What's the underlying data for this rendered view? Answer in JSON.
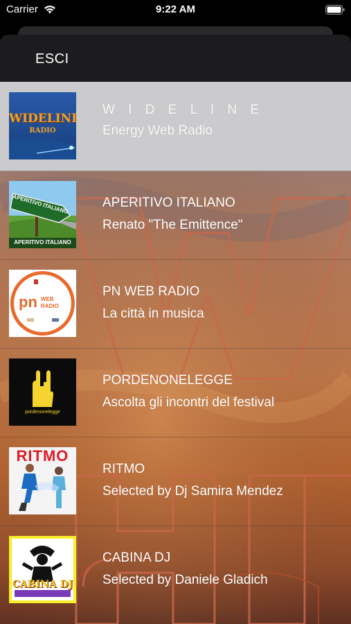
{
  "status_bar": {
    "carrier": "Carrier",
    "time": "9:22 AM"
  },
  "nav": {
    "back_label": "ESCI"
  },
  "stations": [
    {
      "title": "W I D E L I N E",
      "subtitle": "Energy Web Radio",
      "logo_text": "WIDELINE",
      "logo_sub": "RADIO",
      "selected": true
    },
    {
      "title": "APERITIVO ITALIANO",
      "subtitle": "Renato \"The Emittence\"",
      "logo_text": "APERITIVO ITALIANO",
      "logo_sub": "APERITIVO ITALIANO"
    },
    {
      "title": "PN WEB RADIO",
      "subtitle": "La città in musica",
      "logo_text": "pn",
      "logo_sub": "WEB RADIO"
    },
    {
      "title": "PORDENONELEGGE",
      "subtitle": "Ascolta gli incontri del festival",
      "logo_text": "pordenonelegge"
    },
    {
      "title": "RITMO",
      "subtitle": "Selected by Dj Samira Mendez",
      "logo_text": "RITMO"
    },
    {
      "title": "CABINA DJ",
      "subtitle": "Selected by Daniele Gladich",
      "logo_text": "CABINA DJ"
    }
  ],
  "colors": {
    "nav_bg": "#1c1c1e",
    "selected_row_bg": "#cbcacc",
    "text": "#ffffff"
  }
}
